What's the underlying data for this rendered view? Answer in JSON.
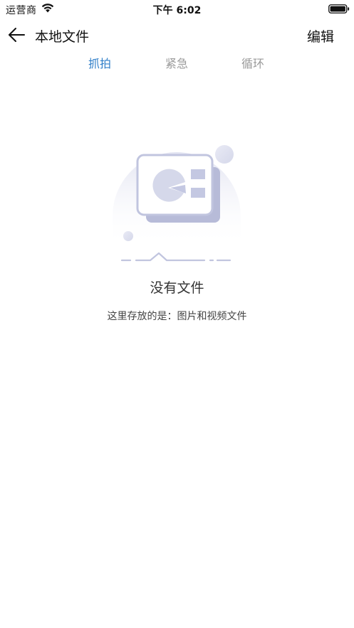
{
  "status_bar": {
    "carrier": "运营商",
    "time": "下午 6:02",
    "wifi_icon": "wifi-icon",
    "battery_icon": "battery-full-icon"
  },
  "nav": {
    "back_icon": "arrow-left-icon",
    "title": "本地文件",
    "edit_label": "编辑"
  },
  "tabs": [
    {
      "label": "抓拍",
      "active": true
    },
    {
      "label": "紧急",
      "active": false
    },
    {
      "label": "循环",
      "active": false
    }
  ],
  "empty_state": {
    "illustration_icon": "empty-files-illustration",
    "title": "没有文件",
    "description": "这里存放的是：图片和视频文件"
  },
  "colors": {
    "accent": "#2f7ec8",
    "tab_inactive": "#9a9a9a",
    "illustration": "#c4c8e2"
  }
}
